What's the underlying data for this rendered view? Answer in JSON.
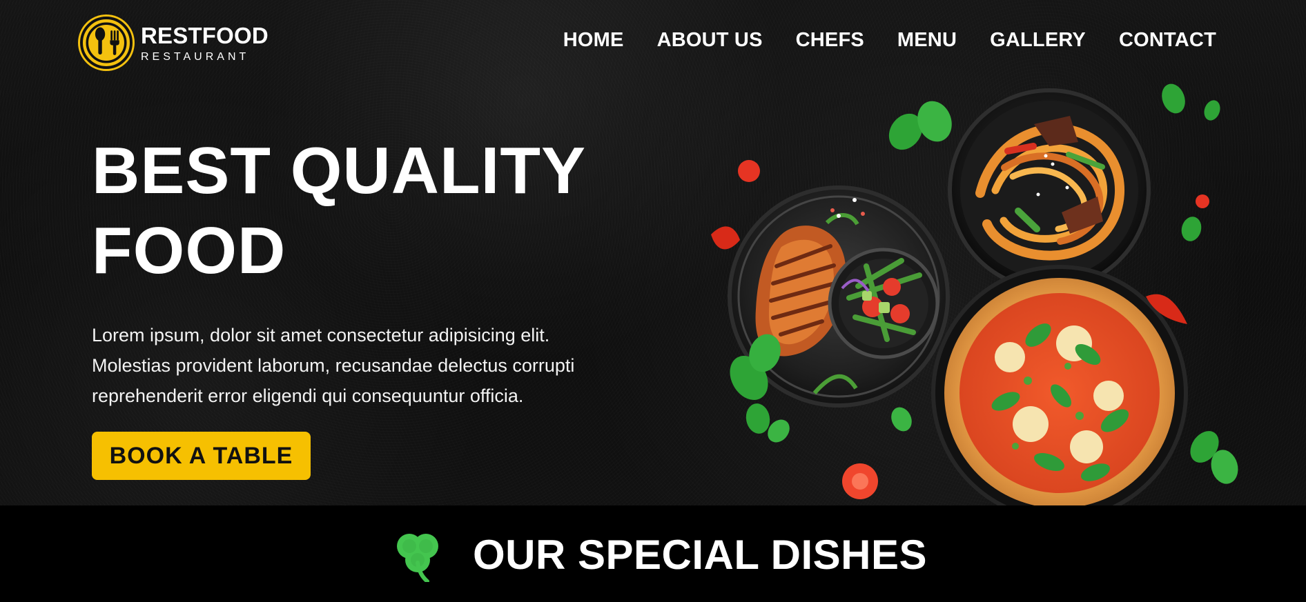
{
  "brand": {
    "title": "RESTFOOD",
    "subtitle": "RESTAURANT",
    "logo_icon": "utensils-icon"
  },
  "nav": {
    "items": [
      {
        "label": "HOME"
      },
      {
        "label": "ABOUT US"
      },
      {
        "label": "CHEFS"
      },
      {
        "label": "MENU"
      },
      {
        "label": "GALLERY"
      },
      {
        "label": "CONTACT"
      }
    ]
  },
  "hero": {
    "title_line1": "BEST QUALITY",
    "title_line2": "FOOD",
    "description_line1": "Lorem ipsum, dolor sit amet consectetur adipisicing elit.",
    "description_line2": "Molestias provident laborum, recusandae delectus corrupti",
    "description_line3": "reprehenderit error eligendi qui consequuntur officia.",
    "button_label": "BOOK A TABLE"
  },
  "special": {
    "title": "OUR SPECIAL DISHES",
    "icon": "shamrock-icon"
  },
  "colors": {
    "accent": "#f6c001",
    "text": "#ffffff",
    "green": "#34c759"
  }
}
